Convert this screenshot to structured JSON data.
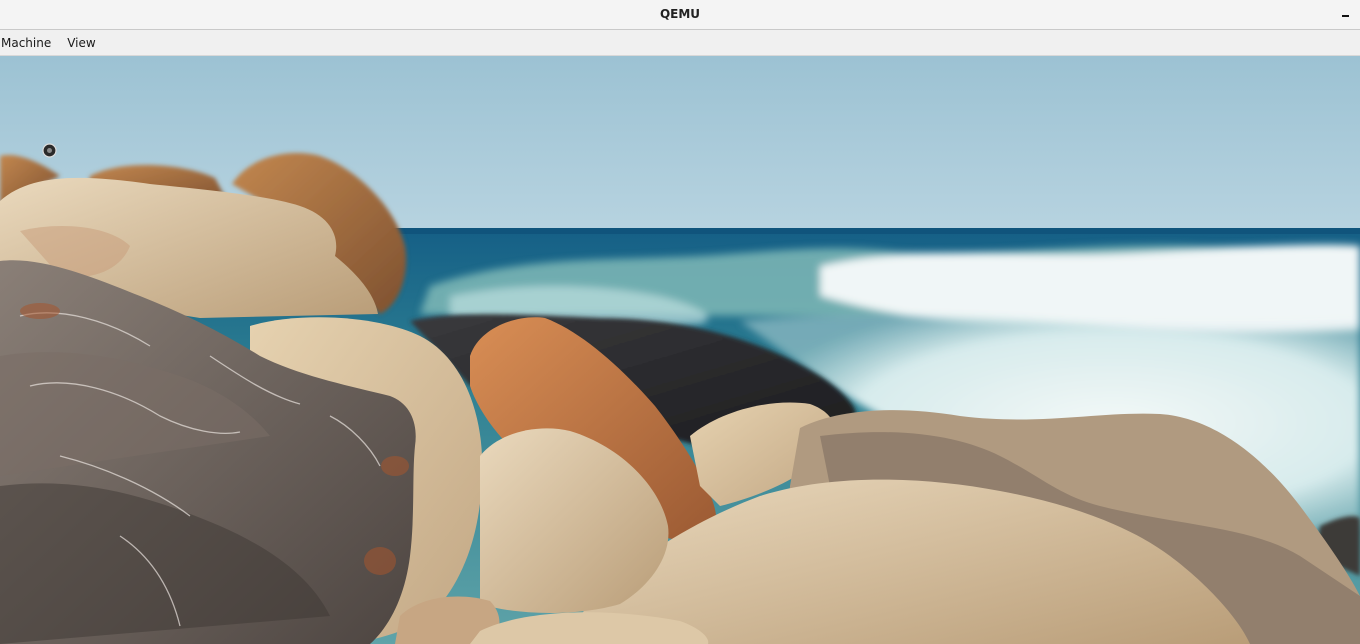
{
  "window": {
    "title": "QEMU",
    "minimize_icon": "minimize-icon"
  },
  "menubar": {
    "items": [
      {
        "label": "Machine"
      },
      {
        "label": "View"
      }
    ]
  },
  "display": {
    "description_icon": "mouse-cursor-icon",
    "colors": {
      "sky": "#9ec3d5",
      "sea": "#1f6f8e",
      "foam": "#e8f3f3",
      "rock_sand": "#d8c4a4",
      "rock_orange": "#c57a44",
      "rock_dark": "#2b2b2e",
      "rock_grey": "#6b625d"
    }
  }
}
